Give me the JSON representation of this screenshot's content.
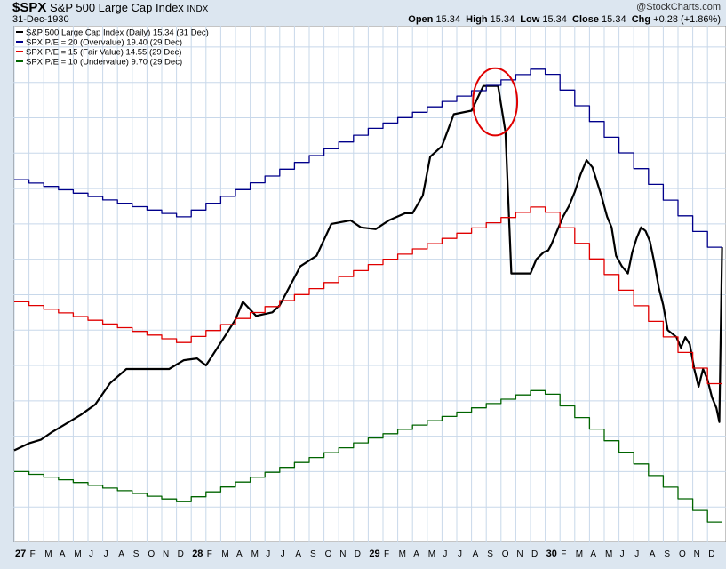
{
  "header": {
    "symbol": "$SPX",
    "name": "S&P 500 Large Cap Index",
    "exchange": "INDX",
    "date": "31-Dec-1930",
    "watermark": "@StockCharts.com",
    "open_label": "Open",
    "open": "15.34",
    "high_label": "High",
    "high": "15.34",
    "low_label": "Low",
    "low": "15.34",
    "close_label": "Close",
    "close": "15.34",
    "chg_label": "Chg",
    "chg": "+0.28 (+1.86%)",
    "chg_color": "#000000"
  },
  "colors": {
    "background": "#ffffff",
    "frame": "#dce6f0",
    "grid": "#c8d8ea",
    "price": "#000000",
    "overvalue": "#00008b",
    "fair": "#e00000",
    "undervalue": "#006400",
    "annotation": "#e00000"
  },
  "chart_data": {
    "type": "line",
    "x_unit": "month",
    "x_start": "1927-01",
    "x_ticks": [
      "27",
      "F",
      "M",
      "A",
      "M",
      "J",
      "J",
      "A",
      "S",
      "O",
      "N",
      "D",
      "28",
      "F",
      "M",
      "A",
      "M",
      "J",
      "J",
      "A",
      "S",
      "O",
      "N",
      "D",
      "29",
      "F",
      "M",
      "A",
      "M",
      "J",
      "J",
      "A",
      "S",
      "O",
      "N",
      "D",
      "30",
      "F",
      "M",
      "A",
      "M",
      "J",
      "J",
      "A",
      "S",
      "O",
      "N",
      "D"
    ],
    "year_ticks": [
      "27",
      "28",
      "29",
      "30"
    ],
    "grid": true,
    "ylim": [
      7.0,
      21.5
    ],
    "legend_position": "top-left",
    "annotation": {
      "type": "circle",
      "color": "red",
      "x_months": [
        31.1,
        34.1
      ],
      "y_range": [
        18.5,
        20.4
      ]
    },
    "series": [
      {
        "name": "S&P 500 Large Cap Index (Daily) 15.34 (31 Dec)",
        "key": "price",
        "x": [
          0,
          1,
          1.8,
          2.5,
          3.3,
          4.5,
          5.5,
          6.5,
          7.6,
          8.6,
          9.8,
          10.5,
          11.5,
          12.4,
          13.0,
          14.4,
          15.0,
          15.5,
          16.4,
          17.5,
          18.0,
          19.4,
          20.5,
          21.5,
          22.8,
          23.5,
          24.5,
          25.4,
          26.5,
          27.0,
          27.7,
          28.2,
          29.0,
          29.8,
          31.0,
          31.8,
          32.8,
          33.3,
          33.7,
          34.2,
          34.5,
          35.0,
          35.4,
          35.9,
          36.2,
          36.4,
          36.8,
          37.2,
          37.6,
          38.0,
          38.4,
          38.8,
          39.2,
          39.5,
          39.8,
          40.2,
          40.5,
          40.8,
          41.2,
          41.6,
          41.9,
          42.2,
          42.5,
          42.8,
          43.1,
          43.4,
          43.7,
          44.0,
          44.3,
          44.6,
          44.9,
          45.2,
          45.5,
          45.8,
          46.1,
          46.4,
          46.7,
          47.0,
          47.3,
          47.6,
          47.8,
          47.99
        ],
        "y": [
          9.6,
          9.8,
          9.9,
          10.1,
          10.3,
          10.6,
          10.9,
          11.5,
          11.9,
          11.9,
          11.9,
          11.9,
          12.15,
          12.2,
          12.0,
          12.9,
          13.3,
          13.8,
          13.4,
          13.5,
          13.7,
          14.8,
          15.1,
          16.0,
          16.1,
          15.9,
          15.85,
          16.1,
          16.3,
          16.3,
          16.8,
          17.9,
          18.2,
          19.1,
          19.2,
          19.9,
          19.9,
          18.6,
          14.6,
          14.6,
          14.6,
          14.6,
          15.0,
          15.2,
          15.25,
          15.4,
          15.8,
          16.2,
          16.5,
          16.9,
          17.4,
          17.8,
          17.6,
          17.2,
          16.8,
          16.2,
          15.9,
          15.1,
          14.8,
          14.6,
          15.2,
          15.6,
          15.9,
          15.8,
          15.5,
          14.9,
          14.2,
          13.7,
          13.0,
          12.9,
          12.8,
          12.5,
          12.8,
          12.6,
          11.9,
          11.4,
          11.9,
          11.6,
          11.1,
          10.8,
          10.4,
          15.34
        ]
      },
      {
        "name": "SPX P/E = 20 (Overvalue) 19.40 (29 Dec)",
        "key": "overvalue",
        "x": [
          0,
          11.0,
          24.0,
          35.5,
          47.99
        ],
        "y": [
          17.25,
          16.2,
          18.7,
          20.45,
          14.9
        ]
      },
      {
        "name": "SPX P/E = 15 (Fair Value) 14.55 (29 Dec)",
        "key": "fair",
        "x": [
          0,
          11.0,
          24.0,
          35.5,
          47.99
        ],
        "y": [
          13.8,
          12.65,
          14.85,
          16.55,
          11.05
        ]
      },
      {
        "name": "SPX P/E = 10 (Undervalue) 9.70 (29 Dec)",
        "key": "undervalue",
        "x": [
          0,
          11.0,
          24.0,
          35.5,
          47.99
        ],
        "y": [
          9.0,
          8.15,
          9.95,
          11.35,
          7.25
        ]
      }
    ]
  }
}
